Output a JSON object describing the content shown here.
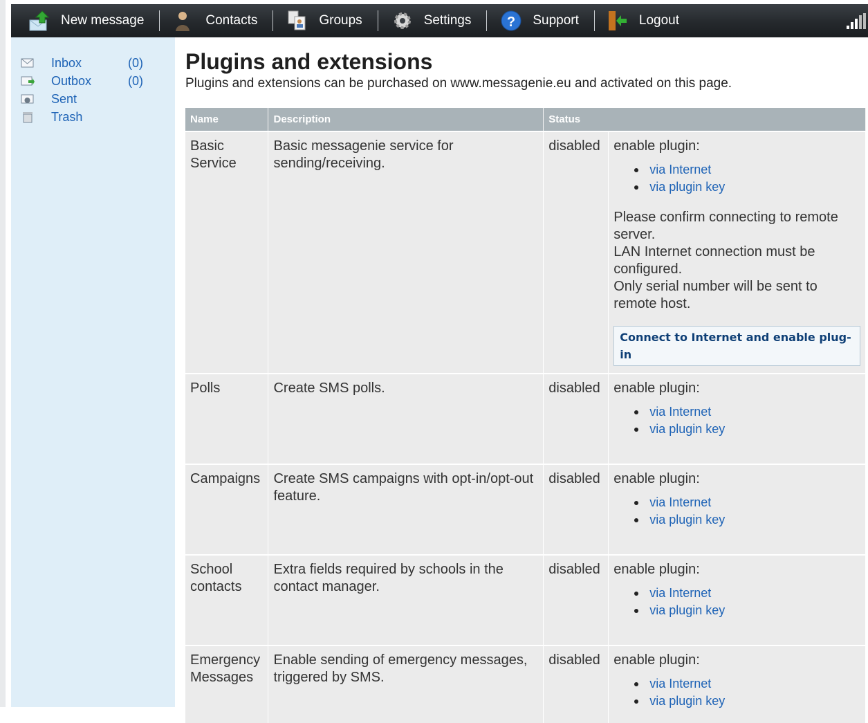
{
  "toolbar": {
    "new_message": "New message",
    "contacts": "Contacts",
    "groups": "Groups",
    "settings": "Settings",
    "support": "Support",
    "logout": "Logout"
  },
  "sidebar": {
    "items": [
      {
        "label": "Inbox",
        "count": "(0)",
        "icon": "inbox-icon"
      },
      {
        "label": "Outbox",
        "count": "(0)",
        "icon": "outbox-icon"
      },
      {
        "label": "Sent",
        "count": "",
        "icon": "sent-icon"
      },
      {
        "label": "Trash",
        "count": "",
        "icon": "trash-icon"
      }
    ]
  },
  "page": {
    "title": "Plugins and extensions",
    "subtitle": "Plugins and extensions can be purchased on www.messagenie.eu and activated on this page."
  },
  "table": {
    "headers": {
      "name": "Name",
      "description": "Description",
      "status": "Status"
    },
    "enable_label": "enable plugin:",
    "link_internet": "via Internet",
    "link_key": "via plugin key",
    "rows": [
      {
        "name": "Basic Service",
        "description": "Basic messagenie service for sending/receiving.",
        "status": "disabled"
      },
      {
        "name": "Polls",
        "description": "Create SMS polls.",
        "status": "disabled"
      },
      {
        "name": "Campaigns",
        "description": "Create SMS campaigns with opt-in/opt-out feature.",
        "status": "disabled"
      },
      {
        "name": "School contacts",
        "description": "Extra fields required by schools in the contact manager.",
        "status": "disabled"
      },
      {
        "name": "Emergency Messages",
        "description": "Enable sending of emergency messages, triggered by SMS.",
        "status": "disabled"
      }
    ],
    "confirm_lines": [
      "Please confirm connecting to remote server.",
      "LAN Internet connection must be configured.",
      "Only serial number will be sent to remote host."
    ],
    "connect_button": "Connect to Internet and enable plug-in"
  },
  "colors": {
    "topbar": "#25292d",
    "sidebar": "#dfeef8",
    "link": "#1e63b6",
    "header_cell": "#a9b3b8",
    "row_cell": "#ebebeb"
  }
}
